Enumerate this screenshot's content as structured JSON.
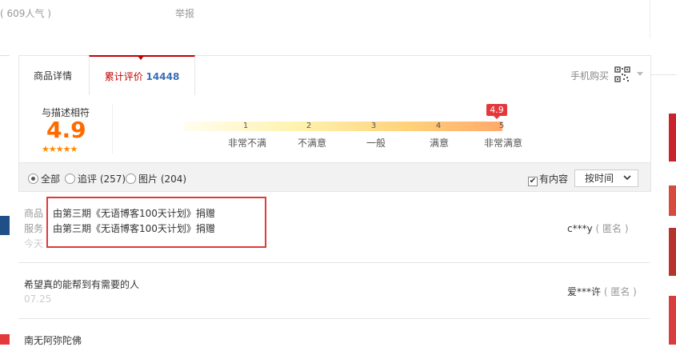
{
  "top": {
    "popularity": "( 609人气 )",
    "report": "举报"
  },
  "tabs": [
    {
      "label": "商品详情"
    },
    {
      "label": "累计评价",
      "count": "14448"
    }
  ],
  "mobile_buy": "手机购买",
  "rating": {
    "label": "与描述相符",
    "score": "4.9",
    "stars": "★★★★★",
    "bubble": "4.9",
    "ticks": [
      "1",
      "2",
      "3",
      "4",
      "5"
    ],
    "levels": [
      "非常不满",
      "不满意",
      "一般",
      "满意",
      "非常满意"
    ]
  },
  "filters": {
    "all": "全部",
    "followup": "追评 (257)",
    "pictures": "图片 (204)",
    "has_content": "有内容",
    "sort": "按时间"
  },
  "reviews": [
    {
      "tag1": "商品",
      "tag2": "服务",
      "line1": "由第三期《无语博客100天计划》捐赠",
      "line2": "由第三期《无语博客100天计划》捐赠",
      "date": "今天",
      "user": "c***y",
      "anon": "( 匿名 )"
    },
    {
      "text": "希望真的能帮到有需要的人",
      "date": "07.25",
      "user": "爱***许",
      "anon": "( 匿名 )"
    },
    {
      "text": "南无阿弥陀佛"
    }
  ],
  "colors": {
    "accent_red": "#c40000",
    "score_orange": "#ff6a00",
    "highlight_box": "#e03a3a"
  }
}
